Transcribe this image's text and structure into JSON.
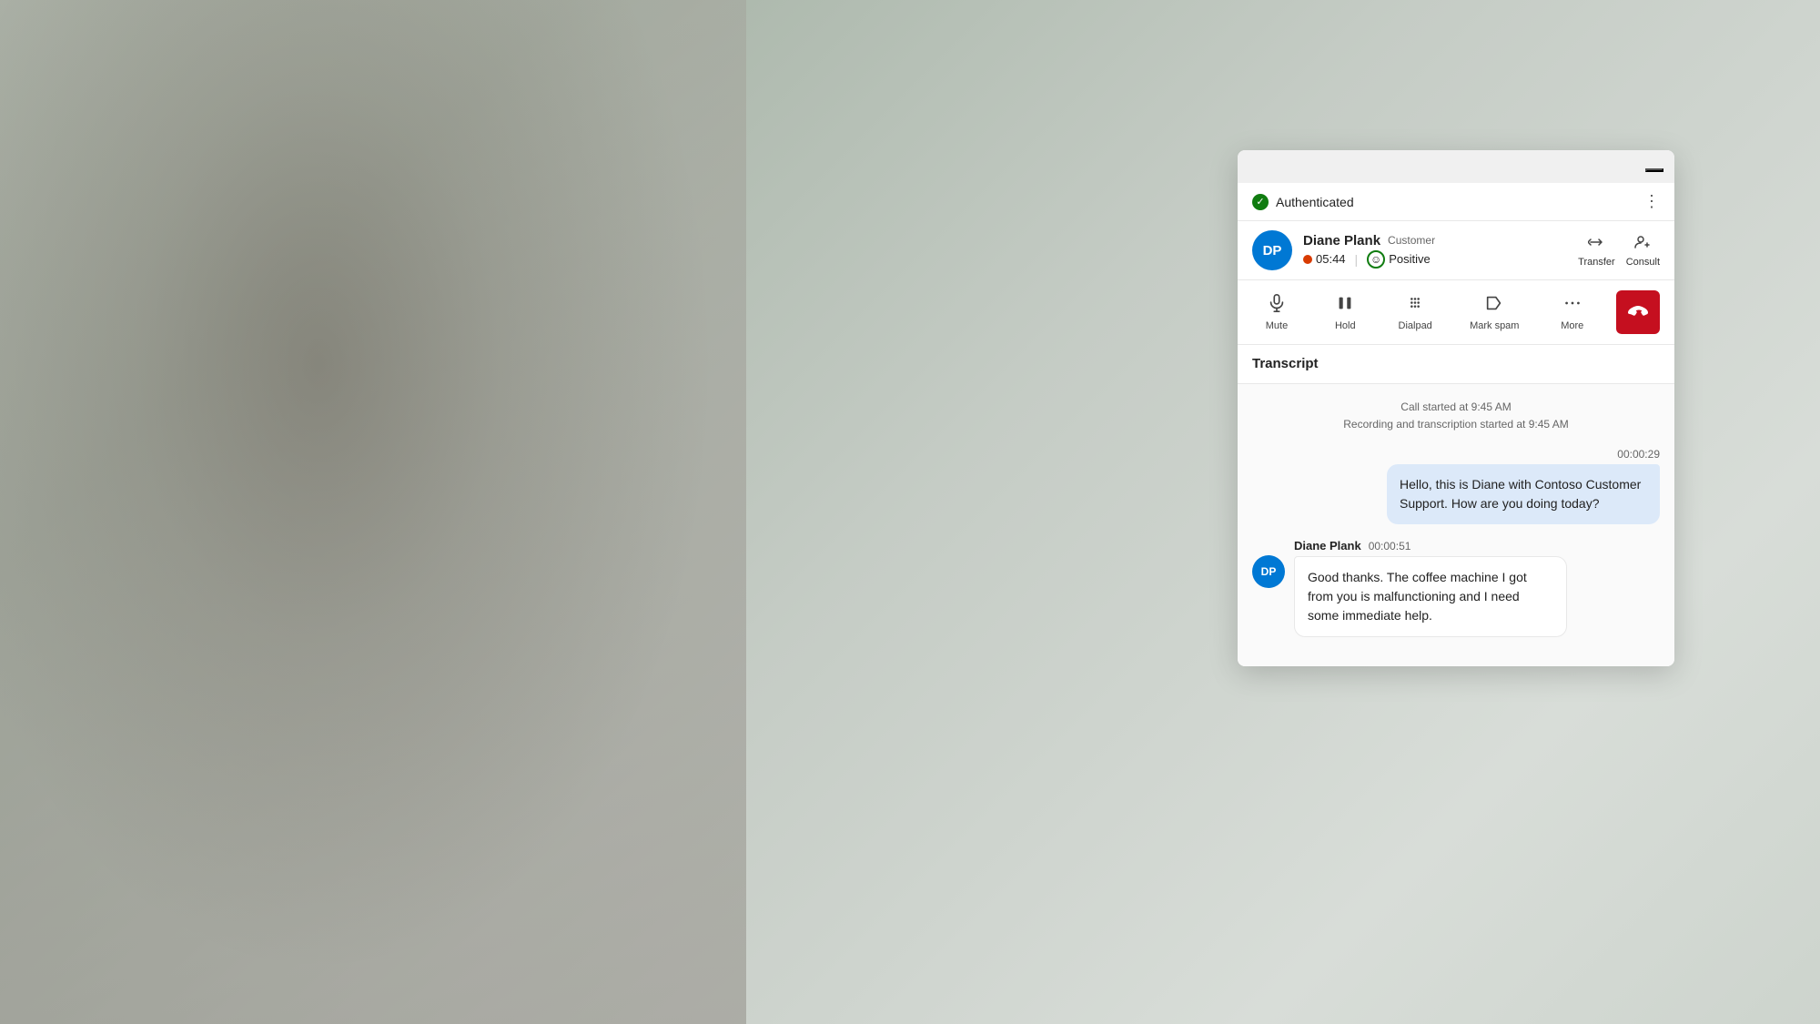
{
  "background": {
    "color": "#c8cfc8"
  },
  "panel": {
    "minimize_btn_label": "—",
    "auth_bar": {
      "status_label": "Authenticated",
      "more_icon": "⋯"
    },
    "caller_bar": {
      "avatar_initials": "DP",
      "avatar_color": "#0078d4",
      "caller_name": "Diane Plank",
      "caller_role": "Customer",
      "timer_value": "05:44",
      "sentiment_label": "Positive",
      "transfer_label": "Transfer",
      "consult_label": "Consult"
    },
    "controls": {
      "mute_label": "Mute",
      "hold_label": "Hold",
      "dialpad_label": "Dialpad",
      "mark_spam_label": "Mark spam",
      "more_label": "More",
      "end_call_label": "End call"
    },
    "transcript": {
      "section_title": "Transcript",
      "call_started": "Call started at 9:45 AM",
      "recording_started": "Recording and transcription started at 9:45 AM",
      "messages": [
        {
          "id": "msg1",
          "type": "outgoing",
          "timestamp": "00:00:29",
          "sender": null,
          "text": "Hello, this is Diane with Contoso Customer Support. How are you doing today?"
        },
        {
          "id": "msg2",
          "type": "incoming",
          "timestamp": "00:00:51",
          "sender": "Diane Plank",
          "avatar_initials": "DP",
          "avatar_color": "#0078d4",
          "text": "Good thanks. The coffee machine I got from you is malfunctioning and I need some immediate help."
        }
      ]
    }
  }
}
